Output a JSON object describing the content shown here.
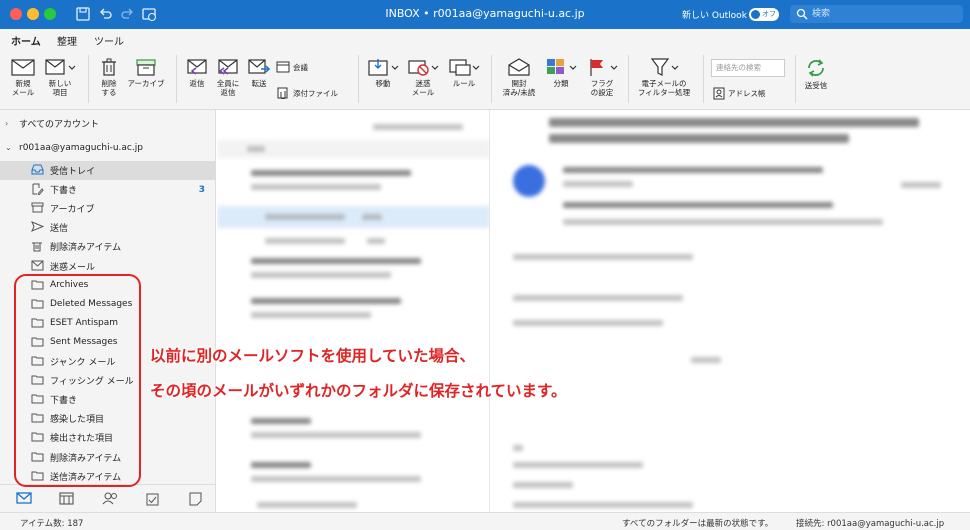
{
  "window": {
    "title": "INBOX • r001aa@yamaguchi-u.ac.jp",
    "new_outlook_label": "新しい Outlook",
    "toggle_label": "オフ",
    "search_placeholder": "検索"
  },
  "ribbon_tabs": [
    "ホーム",
    "整理",
    "ツール"
  ],
  "ribbon": {
    "new_mail": "新規\nメール",
    "new_item": "新しい\n項目",
    "delete": "削除\nする",
    "archive": "アーカイブ",
    "reply": "返信",
    "reply_all": "全員に\n返信",
    "forward": "転送",
    "meeting": "会議",
    "attachment": "添付ファイル",
    "move": "移動",
    "junk": "迷惑\nメール",
    "rules": "ルール",
    "read_unread": "開封\n済み/未読",
    "categorize": "分類",
    "flag": "フラグ\nの設定",
    "filter": "電子メールの\nフィルター処理",
    "contact_search_placeholder": "連絡先の検索",
    "address_book": "アドレス帳",
    "send_receive": "送受信"
  },
  "sidebar": {
    "all_accounts": "すべてのアカウント",
    "account": "r001aa@yamaguchi-u.ac.jp",
    "folders": [
      {
        "label": "受信トレイ",
        "icon": "inbox-icon",
        "selected": true
      },
      {
        "label": "下書き",
        "icon": "draft-icon",
        "count": "3"
      },
      {
        "label": "アーカイブ",
        "icon": "archive-icon"
      },
      {
        "label": "送信",
        "icon": "send-icon"
      },
      {
        "label": "削除済みアイテム",
        "icon": "trash-icon"
      },
      {
        "label": "迷惑メール",
        "icon": "junk-icon"
      },
      {
        "label": "Archives",
        "icon": "folder-icon"
      },
      {
        "label": "Deleted Messages",
        "icon": "folder-icon"
      },
      {
        "label": "ESET Antispam",
        "icon": "folder-icon"
      },
      {
        "label": "Sent Messages",
        "icon": "folder-icon"
      },
      {
        "label": "ジャンク メール",
        "icon": "folder-icon"
      },
      {
        "label": "フィッシング メール",
        "icon": "folder-icon"
      },
      {
        "label": "下書き",
        "icon": "folder-icon"
      },
      {
        "label": "感染した項目",
        "icon": "folder-icon"
      },
      {
        "label": "検出された項目",
        "icon": "folder-icon"
      },
      {
        "label": "削除済みアイテム",
        "icon": "folder-icon"
      },
      {
        "label": "送信済みアイテム",
        "icon": "folder-icon"
      }
    ]
  },
  "annotation": {
    "line1": "以前に別のメールソフトを使用していた場合、",
    "line2": "その頃のメールがいずれかのフォルダに保存されています。"
  },
  "status": {
    "item_count": "アイテム数: 187",
    "sync_state": "すべてのフォルダーは最新の状態です。",
    "connection": "接続先: r001aa@yamaguchi-u.ac.jp"
  },
  "colors": {
    "accent": "#1a73c9",
    "annotation": "#e02424"
  }
}
